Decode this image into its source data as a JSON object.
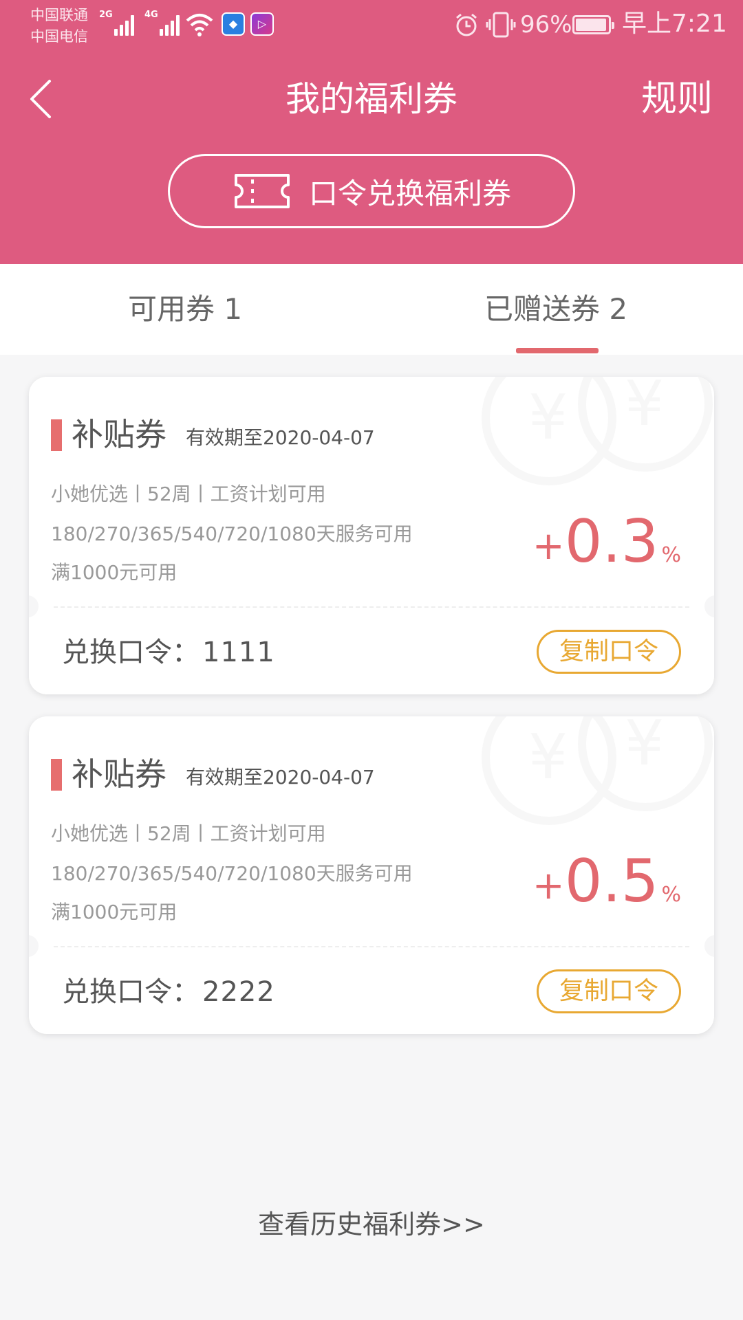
{
  "status_bar": {
    "carrier_1": "中国联通",
    "carrier_2": "中国电信",
    "signal_1_tag": "2G",
    "signal_2_tag": "4G",
    "battery": "96%",
    "time": "早上7:21",
    "icons": [
      "signal-icon",
      "wifi-icon",
      "security-app-icon",
      "video-app-icon",
      "alarm-icon",
      "vibrate-icon",
      "battery-icon"
    ]
  },
  "header": {
    "title": "我的福利券",
    "rules": "规则",
    "redeem_label": "口令兑换福利券"
  },
  "tabs": [
    {
      "label": "可用券 1",
      "active": false
    },
    {
      "label": "已赠送券 2",
      "active": true
    }
  ],
  "coupons": [
    {
      "type": "补贴券",
      "expiry": "有效期至2020-04-07",
      "line1": "小她优选丨52周丨工资计划可用",
      "line2": "180/270/365/540/720/1080天服务可用",
      "line3": "满1000元可用",
      "sign": "+",
      "rate": "0.3",
      "unit": "%",
      "code_label": "兑换口令：",
      "code": "1111",
      "copy_label": "复制口令"
    },
    {
      "type": "补贴券",
      "expiry": "有效期至2020-04-07",
      "line1": "小她优选丨52周丨工资计划可用",
      "line2": "180/270/365/540/720/1080天服务可用",
      "line3": "满1000元可用",
      "sign": "+",
      "rate": "0.5",
      "unit": "%",
      "code_label": "兑换口令：",
      "code": "2222",
      "copy_label": "复制口令"
    }
  ],
  "footer": {
    "history_link": "查看历史福利券>>"
  },
  "colors": {
    "header_bg": "#de5b80",
    "accent_red": "#e2686e",
    "copy_orange": "#e8a832",
    "page_bg": "#f6f6f7"
  }
}
